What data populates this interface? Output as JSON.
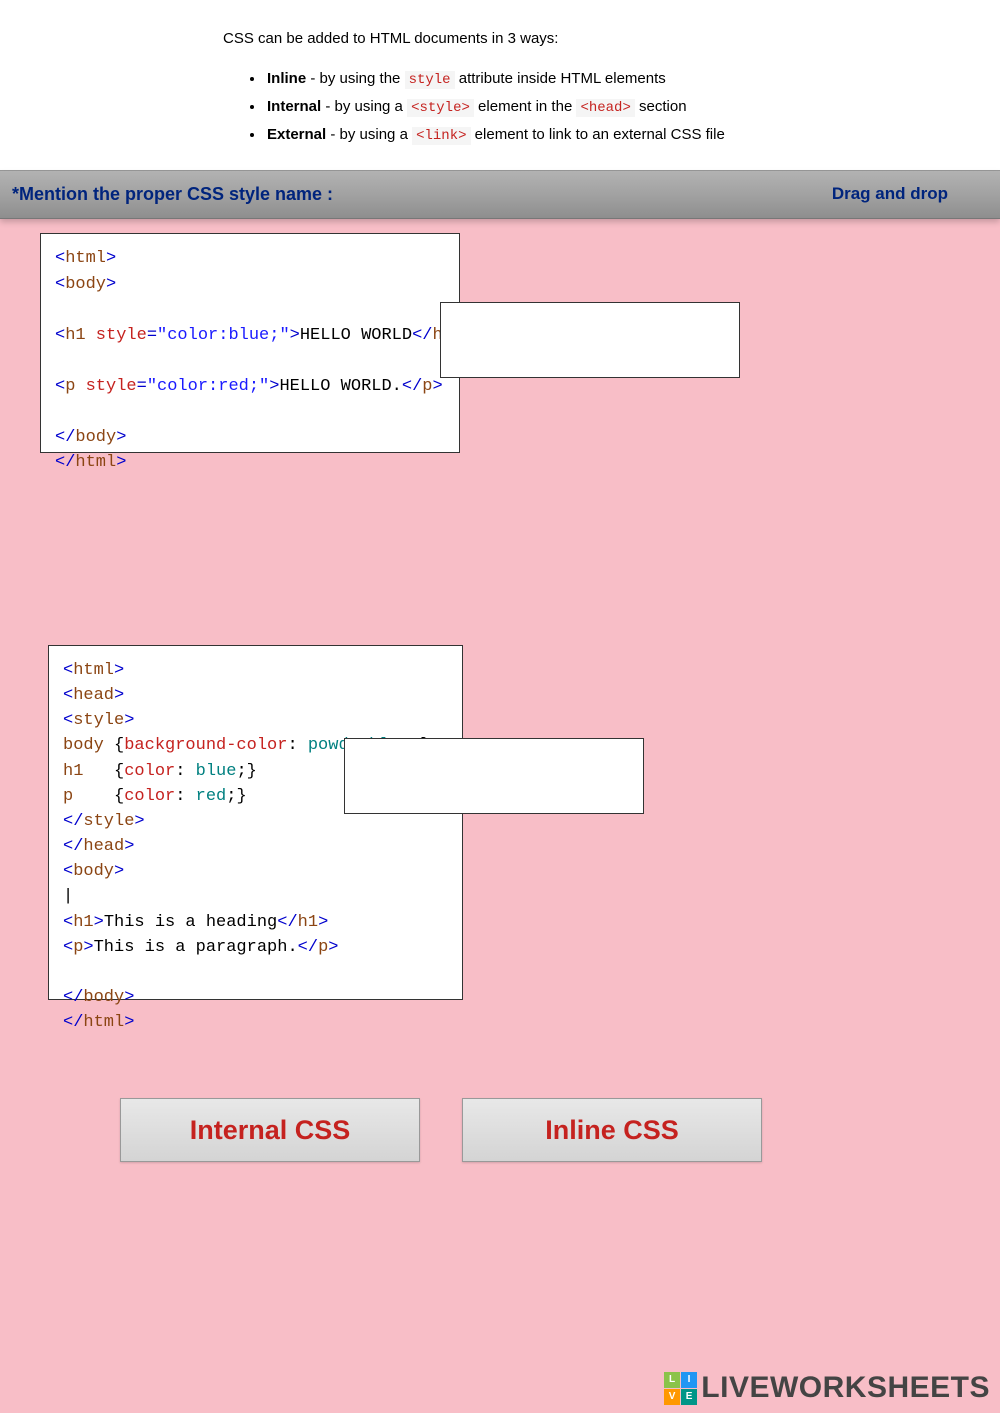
{
  "intro": {
    "text": "CSS can be added to HTML documents in 3 ways:",
    "items": [
      {
        "bold": "Inline",
        "rest": " - by using the ",
        "code": "style",
        "rest2": " attribute inside HTML elements"
      },
      {
        "bold": "Internal",
        "rest": " - by using a ",
        "code": "<style>",
        "rest2": " element in the ",
        "code2": "<head>",
        "rest3": " section"
      },
      {
        "bold": "External",
        "rest": " - by using a ",
        "code": "<link>",
        "rest2": " element to link to an external CSS file"
      }
    ]
  },
  "bar": {
    "left": "*Mention the proper CSS style name :",
    "right": "Drag and drop"
  },
  "code1": {
    "l1a": "<",
    "l1b": "html",
    "l1c": ">",
    "l2a": "<",
    "l2b": "body",
    "l2c": ">",
    "l3a": "<",
    "l3b": "h1",
    "l3c": " style",
    "l3d": "=",
    "l3e": "\"color:blue;\"",
    "l3f": ">",
    "l3g": "HELLO WORLD",
    "l3h": "</",
    "l3i": "h1",
    "l3j": ">",
    "l4a": "<",
    "l4b": "p",
    "l4c": " style",
    "l4d": "=",
    "l4e": "\"color:red;\"",
    "l4f": ">",
    "l4g": "HELLO WORLD.",
    "l4h": "</",
    "l4i": "p",
    "l4j": ">",
    "l5a": "</",
    "l5b": "body",
    "l5c": ">",
    "l6a": "</",
    "l6b": "html",
    "l6c": ">"
  },
  "code2": {
    "l1a": "<",
    "l1b": "html",
    "l1c": ">",
    "l2a": "<",
    "l2b": "head",
    "l2c": ">",
    "l3a": "<",
    "l3b": "style",
    "l3c": ">",
    "l4a": "body ",
    "l4b": "{",
    "l4c": "background-color",
    "l4d": ": ",
    "l4e": "powderblue",
    "l4f": ";}",
    "l5a": "h1   ",
    "l5b": "{",
    "l5c": "color",
    "l5d": ": ",
    "l5e": "blue",
    "l5f": ";}",
    "l6a": "p    ",
    "l6b": "{",
    "l6c": "color",
    "l6d": ": ",
    "l6e": "red",
    "l6f": ";}",
    "l7a": "</",
    "l7b": "style",
    "l7c": ">",
    "l8a": "</",
    "l8b": "head",
    "l8c": ">",
    "l9a": "<",
    "l9b": "body",
    "l9c": ">",
    "cursor": "|",
    "l10a": "<",
    "l10b": "h1",
    "l10c": ">",
    "l10d": "This is a heading",
    "l10e": "</",
    "l10f": "h1",
    "l10g": ">",
    "l11a": "<",
    "l11b": "p",
    "l11c": ">",
    "l11d": "This is a paragraph.",
    "l11e": "</",
    "l11f": "p",
    "l11g": ">",
    "l12a": "</",
    "l12b": "body",
    "l12c": ">",
    "l13a": "</",
    "l13b": "html",
    "l13c": ">"
  },
  "drag": {
    "internal": "Internal CSS",
    "inline": "Inline CSS"
  },
  "watermark": {
    "l": "L",
    "i": "I",
    "v": "V",
    "e": "E",
    "text": "LIVEWORKSHEETS"
  }
}
